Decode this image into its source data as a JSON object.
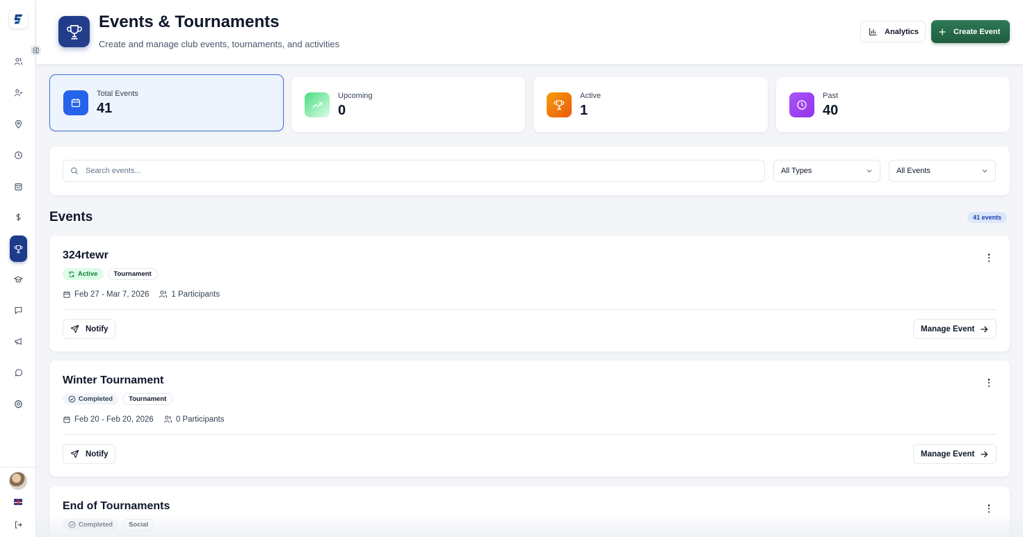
{
  "sidebar": {
    "items": [
      {
        "name": "members",
        "icon": "users-icon"
      },
      {
        "name": "coaches",
        "icon": "user-check-icon"
      },
      {
        "name": "locations",
        "icon": "map-pin-icon"
      },
      {
        "name": "schedule",
        "icon": "clock-icon"
      },
      {
        "name": "shop",
        "icon": "shopping-bag-icon"
      },
      {
        "name": "finance",
        "icon": "dollar-icon"
      },
      {
        "name": "events",
        "icon": "trophy-icon",
        "active": true
      },
      {
        "name": "academy",
        "icon": "graduation-cap-icon"
      },
      {
        "name": "messages",
        "icon": "message-square-icon"
      },
      {
        "name": "announcements",
        "icon": "megaphone-icon"
      },
      {
        "name": "chat",
        "icon": "message-circle-icon"
      },
      {
        "name": "settings",
        "icon": "gear-icon"
      }
    ]
  },
  "header": {
    "title": "Events & Tournaments",
    "subtitle": "Create and manage club events, tournaments, and activities",
    "analytics_label": "Analytics",
    "create_label": "Create Event"
  },
  "stats": [
    {
      "label": "Total Events",
      "value": "41",
      "icon": "calendar-icon",
      "color": "#2563eb"
    },
    {
      "label": "Upcoming",
      "value": "0",
      "icon": "trending-up-icon",
      "color": "#4ade80"
    },
    {
      "label": "Active",
      "value": "1",
      "icon": "trophy-icon",
      "color": "#f59e0b"
    },
    {
      "label": "Past",
      "value": "40",
      "icon": "clock-icon",
      "color": "#a855f7"
    }
  ],
  "filters": {
    "search_placeholder": "Search events...",
    "type_value": "All Types",
    "status_value": "All Events"
  },
  "events_section": {
    "heading": "Events",
    "count": "41 events"
  },
  "events": [
    {
      "title": "324rtewr",
      "status": "Active",
      "type": "Tournament",
      "dates": "Feb 27 - Mar 7, 2026",
      "participants": "1 Participants",
      "notify_label": "Notify",
      "manage_label": "Manage Event"
    },
    {
      "title": "Winter Tournament",
      "status": "Completed",
      "type": "Tournament",
      "dates": "Feb 20 - Feb 20, 2026",
      "participants": "0 Participants",
      "notify_label": "Notify",
      "manage_label": "Manage Event"
    },
    {
      "title": "End of Tournaments",
      "status": "Completed",
      "type": "Social"
    }
  ],
  "colors": {
    "accent": "#1e3a8a",
    "create_button": "#1f5c3f",
    "active_badge": "#15803d"
  }
}
